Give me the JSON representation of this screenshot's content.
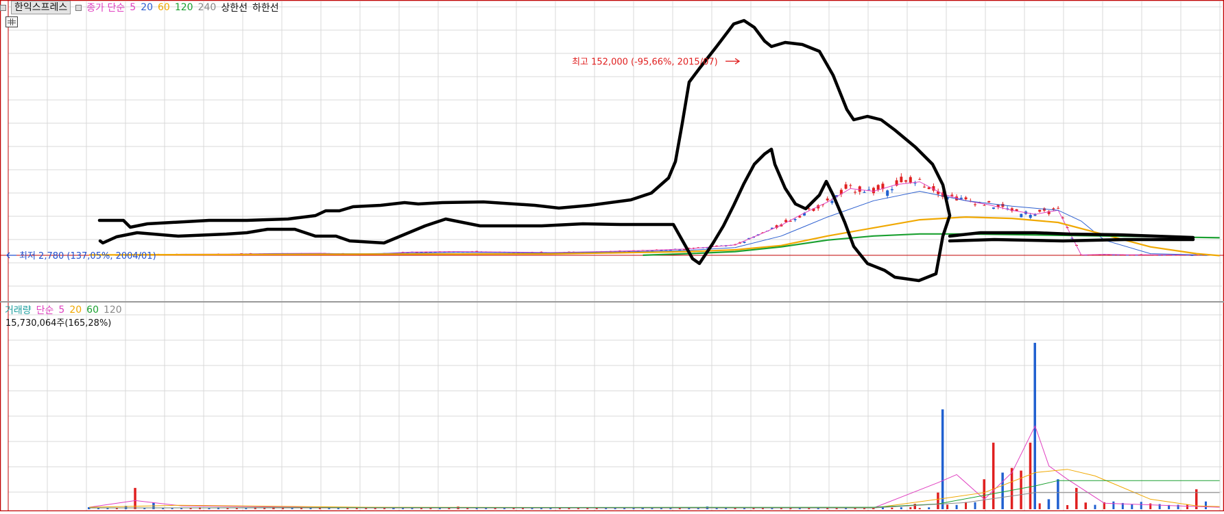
{
  "price_panel": {
    "stock_name": "한익스프레스",
    "ma_label": "종가 단순",
    "ma_periods": [
      "5",
      "20",
      "60",
      "120",
      "240"
    ],
    "ma_colors": [
      "#e040c0",
      "#2c5fd0",
      "#f0a800",
      "#1aa030",
      "#888888"
    ],
    "upper_limit_label": "상한선",
    "lower_limit_label": "하한선",
    "high_annotation": "최고 152,000 (-95,66%, 2015/07)",
    "low_annotation": "최저 2,780 (137,05%, 2004/01)"
  },
  "volume_panel": {
    "label": "거래량",
    "ma_label": "단순",
    "ma_periods": [
      "5",
      "20",
      "60",
      "120"
    ],
    "ma_colors": [
      "#e040c0",
      "#f0a800",
      "#1aa030",
      "#888888"
    ],
    "current_volume": "15,730,064주(165,28%)"
  },
  "colors": {
    "up_candle": "#e02020",
    "down_candle": "#2060d0",
    "grid": "#d8d8d8",
    "frame": "#c00000",
    "annotation_red": "#e02020",
    "annotation_blue": "#2050d0",
    "overlay_stroke": "#000000"
  },
  "chart_data": [
    {
      "type": "candlestick",
      "x_unit": "period index (about 245 periods, roughly 2003 to 2024)",
      "series": [
        {
          "name": "5",
          "x": [
            0,
            10,
            20,
            30,
            40,
            50,
            60,
            70,
            80,
            90,
            100,
            110,
            120,
            130,
            140,
            150,
            155,
            160,
            165,
            170,
            175,
            180,
            185,
            190,
            195,
            200,
            205,
            210,
            215,
            220,
            225,
            230,
            240
          ],
          "values": [
            3000,
            2900,
            3600,
            3700,
            4100,
            4300,
            3500,
            5200,
            5500,
            5200,
            4800,
            5400,
            6300,
            7500,
            10500,
            25000,
            34000,
            42000,
            52000,
            50000,
            55000,
            57000,
            48000,
            43000,
            40000,
            36000,
            33000,
            36000,
            3000,
            3500,
            3200,
            3100,
            3000
          ]
        },
        {
          "name": "20",
          "x": [
            0,
            20,
            40,
            60,
            80,
            100,
            120,
            130,
            140,
            150,
            155,
            160,
            170,
            180,
            190,
            200,
            210,
            215,
            220,
            230,
            240
          ],
          "values": [
            3100,
            3100,
            3900,
            4000,
            4900,
            4500,
            5600,
            6500,
            8500,
            17000,
            24000,
            31000,
            43000,
            50000,
            43000,
            39000,
            36000,
            28000,
            14000,
            4000,
            3100
          ]
        },
        {
          "name": "60",
          "x": [
            0,
            60,
            100,
            120,
            130,
            140,
            150,
            160,
            170,
            180,
            190,
            200,
            210,
            220,
            230,
            240,
            245
          ],
          "values": [
            3000,
            3600,
            3800,
            4900,
            5500,
            6800,
            10000,
            17000,
            23000,
            29000,
            31000,
            30000,
            27000,
            18000,
            9000,
            4000,
            2500
          ]
        },
        {
          "name": "120",
          "x": [
            120,
            130,
            140,
            150,
            160,
            170,
            180,
            190,
            200,
            210,
            220,
            230,
            240,
            245
          ],
          "values": [
            2800,
            4000,
            5500,
            9000,
            14000,
            17000,
            18500,
            18500,
            18000,
            17500,
            17000,
            16500,
            16000,
            15700
          ]
        }
      ],
      "high": {
        "value": 152000,
        "period": "2015/07",
        "x": 140
      },
      "low": {
        "value": 2780,
        "period": "2004/01",
        "x": 0
      },
      "ylim": [
        -25000,
        180000
      ],
      "grid": true
    },
    {
      "type": "bar",
      "series_name": "거래량",
      "x": [
        0,
        8,
        10,
        14,
        40,
        66,
        80,
        120,
        134,
        170,
        179,
        184,
        185,
        194,
        196,
        198,
        200,
        202,
        204,
        205,
        208,
        210,
        214,
        216,
        240
      ],
      "values": [
        0.3,
        0.5,
        3.2,
        1.0,
        0.3,
        0.2,
        0.4,
        0.3,
        0.4,
        0.2,
        0.8,
        2.5,
        15.0,
        4.5,
        10.0,
        5.5,
        6.2,
        5.8,
        10.0,
        25.0,
        1.5,
        4.5,
        3.2,
        1.0,
        3.0
      ],
      "ma": [
        {
          "name": "5",
          "x": [
            0,
            10,
            20,
            60,
            170,
            184,
            188,
            194,
            200,
            205,
            208,
            212,
            220,
            240,
            245
          ],
          "values": [
            0.3,
            1.3,
            0.5,
            0.2,
            0.2,
            4.0,
            5.2,
            1.5,
            5.5,
            12.5,
            6.5,
            4.5,
            0.9,
            0.4,
            0.3
          ]
        },
        {
          "name": "20",
          "x": [
            0,
            20,
            60,
            170,
            184,
            194,
            205,
            212,
            218,
            230,
            240,
            245
          ],
          "values": [
            0.3,
            0.6,
            0.3,
            0.2,
            1.5,
            2.5,
            5.5,
            6.0,
            5.0,
            1.5,
            0.5,
            0.4
          ]
        },
        {
          "name": "60",
          "x": [
            0,
            60,
            170,
            184,
            205,
            210,
            240,
            245
          ],
          "values": [
            0.2,
            0.25,
            0.3,
            0.8,
            3.5,
            4.3,
            4.3,
            4.3
          ]
        },
        {
          "name": "120",
          "x": [
            0,
            170,
            190,
            205,
            215,
            240,
            245
          ],
          "values": [
            0.2,
            0.2,
            1.0,
            2.5,
            2.5,
            2.5,
            2.5
          ]
        }
      ],
      "ylim": [
        0,
        29
      ],
      "grid": true
    }
  ]
}
